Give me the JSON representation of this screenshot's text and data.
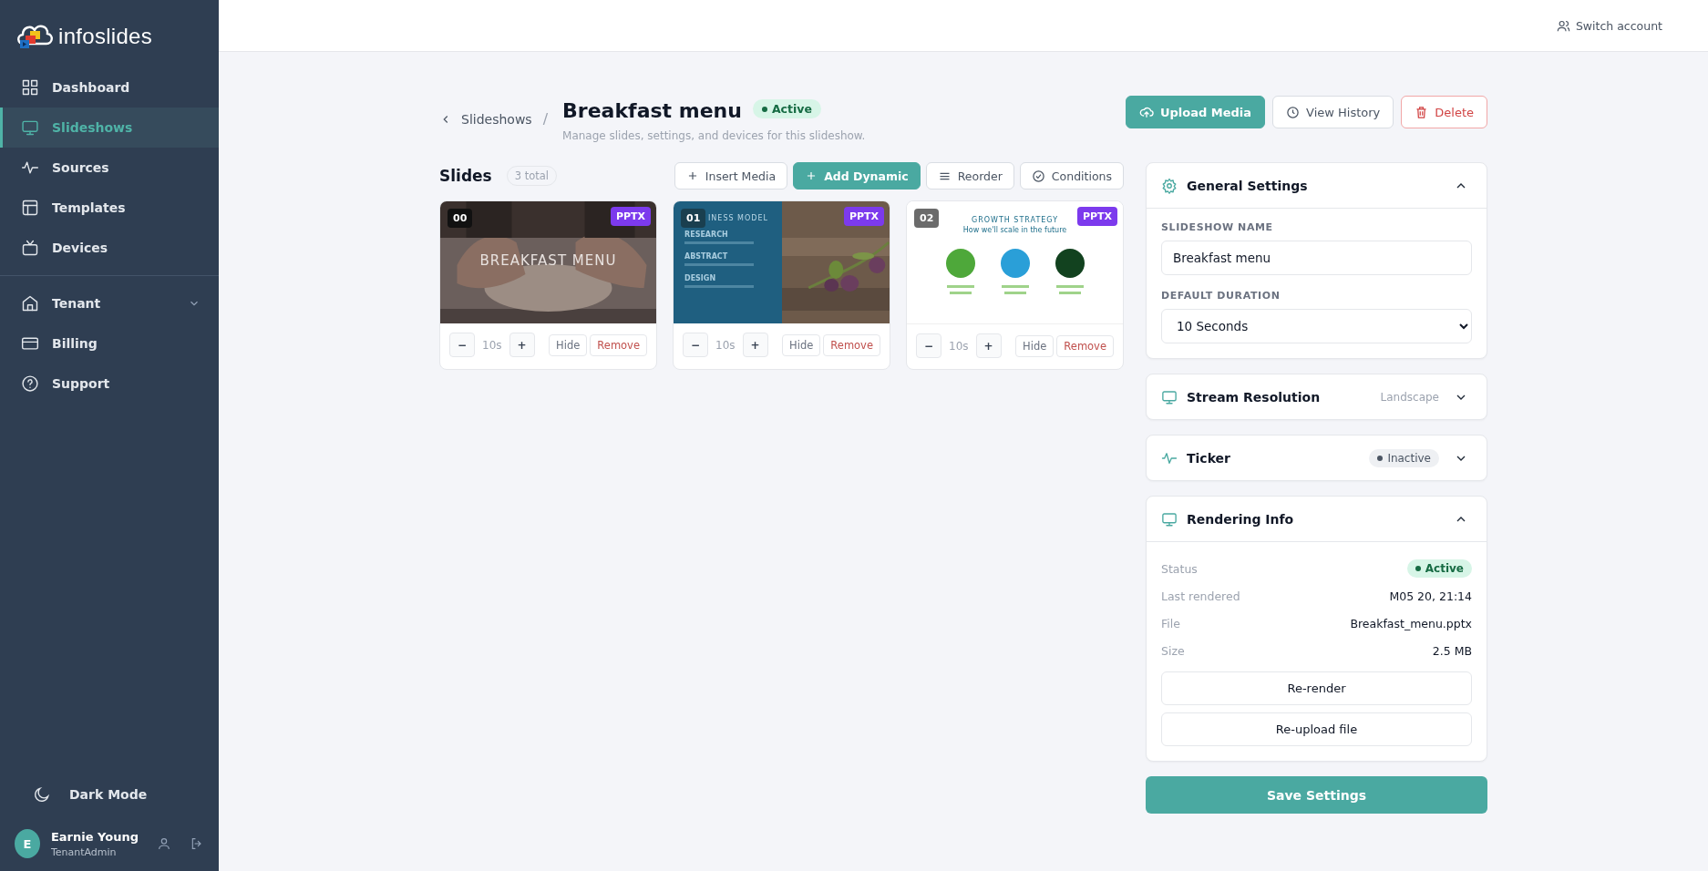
{
  "brand": {
    "name": "infoslides"
  },
  "sidebar": {
    "items": [
      {
        "label": "Dashboard",
        "selected": false
      },
      {
        "label": "Slideshows",
        "selected": true
      },
      {
        "label": "Sources",
        "selected": false
      },
      {
        "label": "Templates",
        "selected": false
      },
      {
        "label": "Devices",
        "selected": false
      }
    ],
    "admin_items": [
      {
        "label": "Tenant",
        "selected": false,
        "expanded": false
      },
      {
        "label": "Billing",
        "selected": false
      },
      {
        "label": "Support",
        "selected": false
      }
    ],
    "dark_mode": {
      "label": "Dark Mode"
    },
    "user": {
      "initial": "E",
      "name": "Earnie Young",
      "role": "TenantAdmin"
    }
  },
  "top_bar": {
    "switch_account": "Switch account"
  },
  "header": {
    "breadcrumb": "Slideshows",
    "separator": "/",
    "title": "Breakfast menu",
    "status": {
      "label": "Active",
      "kind": "active"
    },
    "subtitle": "Manage slides, settings, and devices for this slideshow.",
    "actions": [
      {
        "label": "Upload Media",
        "kind": "primary"
      },
      {
        "label": "View History",
        "kind": "default"
      },
      {
        "label": "Delete",
        "kind": "danger"
      }
    ]
  },
  "slides": {
    "title": "Slides",
    "count": "3 total",
    "toolbar": [
      {
        "label": "Insert Media",
        "kind": "default"
      },
      {
        "label": "Add Dynamic",
        "kind": "primary"
      },
      {
        "label": "Reorder",
        "kind": "default"
      },
      {
        "label": "Conditions",
        "kind": "default"
      }
    ],
    "items": [
      {
        "index": "00",
        "type": "PPTX",
        "duration": "10s",
        "minus": "−",
        "plus": "+",
        "hide": "Hide",
        "remove": "Remove",
        "thumbnail": {
          "title": "BREAKFAST MENU"
        }
      },
      {
        "index": "01",
        "type": "PPTX",
        "duration": "10s",
        "minus": "−",
        "plus": "+",
        "hide": "Hide",
        "remove": "Remove",
        "thumbnail": {
          "kind": "split",
          "title": "INESS MODEL",
          "headings": [
            "RESEARCH",
            "ABSTRACT",
            "DESIGN"
          ]
        }
      },
      {
        "index": "02",
        "type": "PPTX",
        "duration": "10s",
        "minus": "−",
        "plus": "+",
        "hide": "Hide",
        "remove": "Remove",
        "thumbnail": {
          "kind": "timeline",
          "title": "GROWTH STRATEGY",
          "subtitle": "How we'll scale in the future"
        }
      }
    ]
  },
  "settings": {
    "panels": [
      {
        "kind": "general",
        "title": "General Settings",
        "expanded": true,
        "fields": [
          {
            "label": "SLIDESHOW NAME",
            "kind": "text",
            "value": "Breakfast menu"
          },
          {
            "label": "DEFAULT DURATION",
            "kind": "select",
            "value": "10 Seconds"
          }
        ]
      },
      {
        "kind": "resolution",
        "title": "Stream Resolution",
        "expanded": false,
        "value": "Landscape"
      },
      {
        "kind": "ticker",
        "title": "Ticker",
        "expanded": false,
        "status": {
          "label": "Inactive",
          "kind": "inactive"
        }
      },
      {
        "kind": "rendering",
        "title": "Rendering Info",
        "expanded": true,
        "rows": [
          {
            "label": "Status",
            "badge": {
              "label": "Active",
              "kind": "active"
            }
          },
          {
            "label": "Last rendered",
            "value": "M05 20, 21:14"
          },
          {
            "label": "File",
            "value": "Breakfast_menu.pptx"
          },
          {
            "label": "Size",
            "value": "2.5 MB"
          }
        ],
        "buttons": [
          "Re-render",
          "Re-upload file"
        ]
      }
    ],
    "save": "Save Settings"
  }
}
